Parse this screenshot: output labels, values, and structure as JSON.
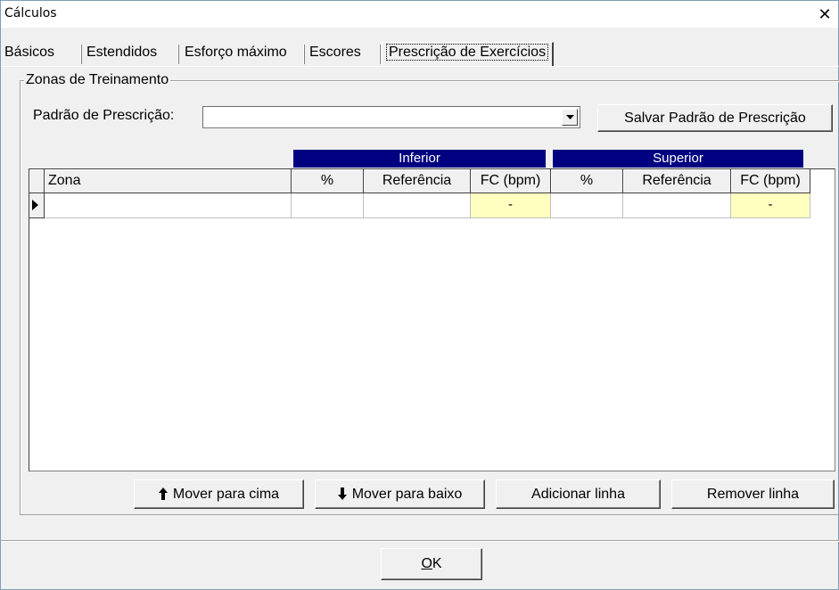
{
  "window": {
    "title": "Cálculos",
    "close_glyph": "✕"
  },
  "tabs": [
    {
      "label": "Básicos"
    },
    {
      "label": "Estendidos"
    },
    {
      "label": "Esforço máximo"
    },
    {
      "label": "Escores"
    },
    {
      "label": "Prescrição de Exercícios",
      "active": true
    }
  ],
  "group": {
    "title": "Zonas de Treinamento",
    "pattern_label": "Padrão de Prescrição:",
    "pattern_value": "",
    "save_button": "Salvar Padrão de Prescrição"
  },
  "grid": {
    "bands": {
      "inferior": "Inferior",
      "superior": "Superior"
    },
    "columns": [
      "Zona",
      "%",
      "Referência",
      "FC (bpm)",
      "%",
      "Referência",
      "FC (bpm)"
    ],
    "rows": [
      {
        "zona": "",
        "inf_pct": "",
        "inf_ref": "",
        "inf_fc": "-",
        "sup_pct": "",
        "sup_ref": "",
        "sup_fc": "-"
      }
    ],
    "highlight_color": "#ffffc0",
    "band_color": "#000080"
  },
  "buttons": {
    "move_up": "Mover para cima",
    "move_down": "Mover para baixo",
    "add_row": "Adicionar linha",
    "remove_row": "Remover linha",
    "ok_accel": "O",
    "ok_rest": "K"
  }
}
